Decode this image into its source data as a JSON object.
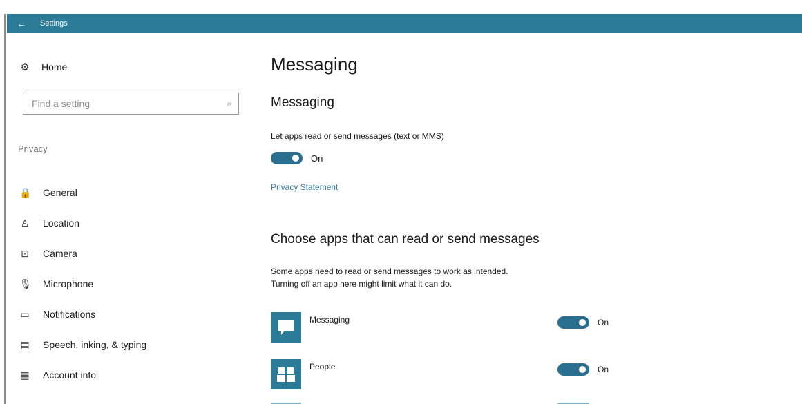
{
  "window": {
    "back_glyph": "←",
    "title": "Settings"
  },
  "sidebar": {
    "home": {
      "icon": "gear-icon",
      "glyph": "⚙",
      "label": "Home"
    },
    "search": {
      "placeholder": "Find a setting",
      "icon": "search-icon",
      "glyph": "⌕"
    },
    "section_label": "Privacy",
    "items": [
      {
        "icon": "lock-icon",
        "glyph": "🔒",
        "label": "General"
      },
      {
        "icon": "location-icon",
        "glyph": "♙",
        "label": "Location"
      },
      {
        "icon": "camera-icon",
        "glyph": "⊡",
        "label": "Camera"
      },
      {
        "icon": "microphone-icon",
        "glyph": "🎙",
        "label": "Microphone"
      },
      {
        "icon": "notifications-icon",
        "glyph": "▭",
        "label": "Notifications"
      },
      {
        "icon": "speech-icon",
        "glyph": "▤",
        "label": "Speech, inking, & typing"
      },
      {
        "icon": "account-info-icon",
        "glyph": "▦",
        "label": "Account info"
      }
    ]
  },
  "main": {
    "page_title": "Messaging",
    "section_title": "Messaging",
    "setting_description": "Let apps read or send messages (text or MMS)",
    "main_toggle_state": "On",
    "privacy_link": "Privacy Statement",
    "apps_title": "Choose apps that can read or send messages",
    "apps_description_line1": "Some apps need to read or send messages to work as intended.",
    "apps_description_line2": "Turning off an app here might limit what it can do.",
    "apps": [
      {
        "name": "Messaging",
        "icon": "messaging-app-icon",
        "glyph": "▭",
        "state": "On"
      },
      {
        "name": "People",
        "icon": "people-app-icon",
        "glyph": "👥",
        "state": "On"
      }
    ]
  },
  "colors": {
    "accent": "#2b7a96",
    "toggle_on": "#2b6f8f",
    "link": "#3c7aa6"
  }
}
